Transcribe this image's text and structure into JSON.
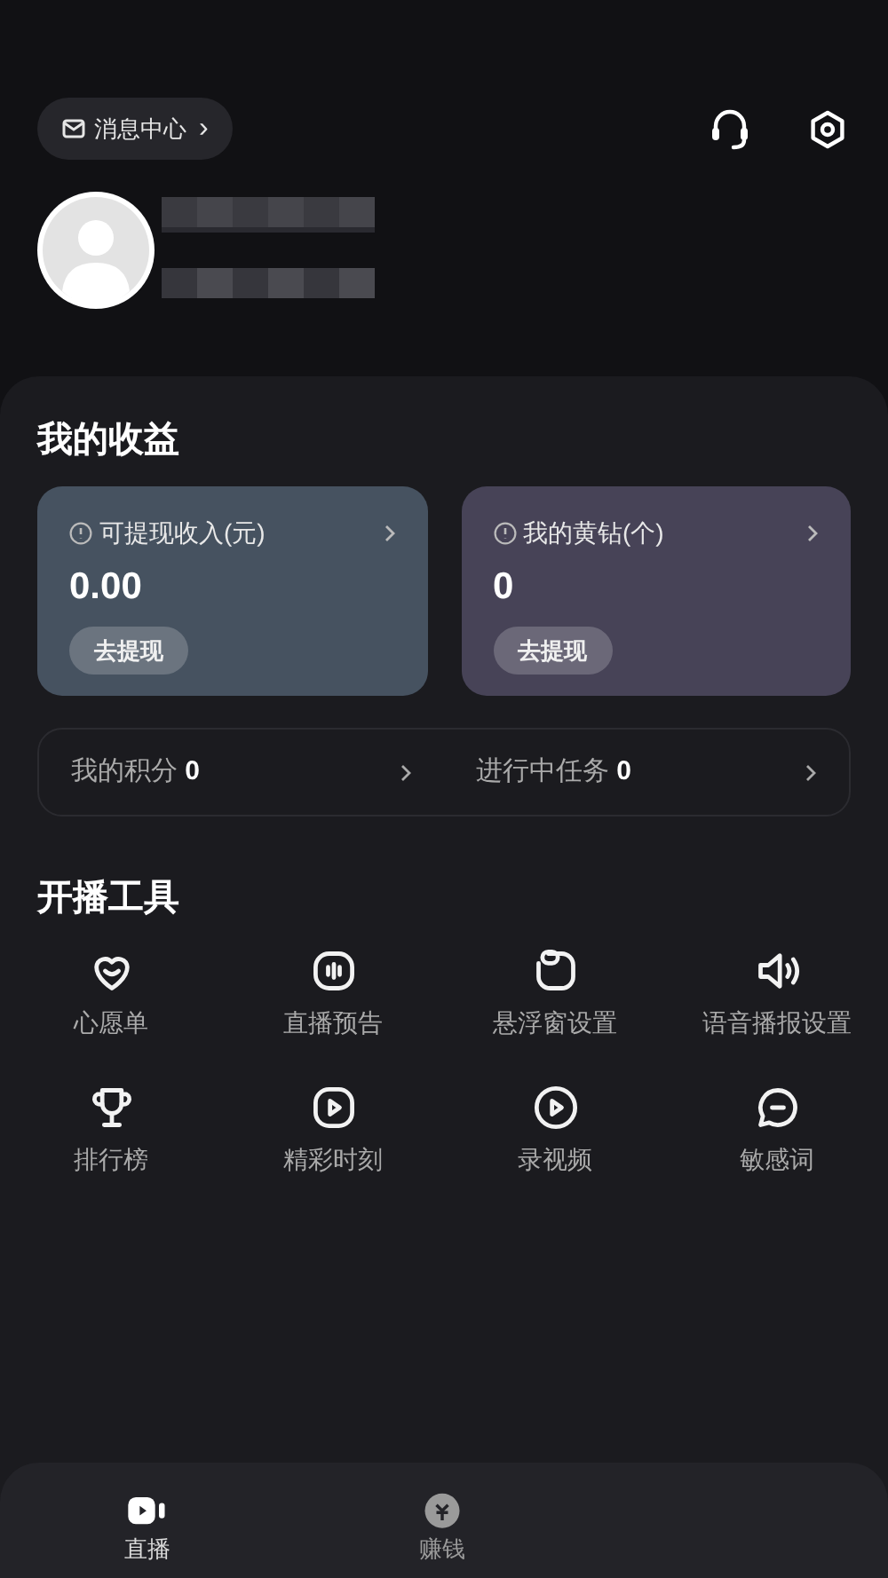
{
  "header": {
    "message_center": "消息中心",
    "chevron": "›"
  },
  "profile": {
    "name_blurred": true
  },
  "earnings": {
    "title": "我的收益",
    "cards": [
      {
        "label": "可提现收入(元)",
        "value": "0.00",
        "button": "去提现",
        "color": "#465260"
      },
      {
        "label": "我的黄钻(个)",
        "value": "0",
        "button": "去提现",
        "color": "#474357"
      }
    ],
    "stats": [
      {
        "label": "我的积分",
        "value": "0"
      },
      {
        "label": "进行中任务",
        "value": "0"
      }
    ]
  },
  "tools": {
    "title": "开播工具",
    "items": [
      {
        "kind": "heart",
        "label": "心愿单"
      },
      {
        "kind": "wave",
        "label": "直播预告"
      },
      {
        "kind": "float",
        "label": "悬浮窗设置"
      },
      {
        "kind": "speaker",
        "label": "语音播报设置"
      },
      {
        "kind": "trophy",
        "label": "排行榜"
      },
      {
        "kind": "play-square",
        "label": "精彩时刻"
      },
      {
        "kind": "play-circle",
        "label": "录视频"
      },
      {
        "kind": "chat",
        "label": "敏感词"
      }
    ]
  },
  "tab_bar": [
    {
      "kind": "camera",
      "label": "直播",
      "selected": true
    },
    {
      "kind": "coin",
      "label": "赚钱",
      "selected": false
    }
  ]
}
